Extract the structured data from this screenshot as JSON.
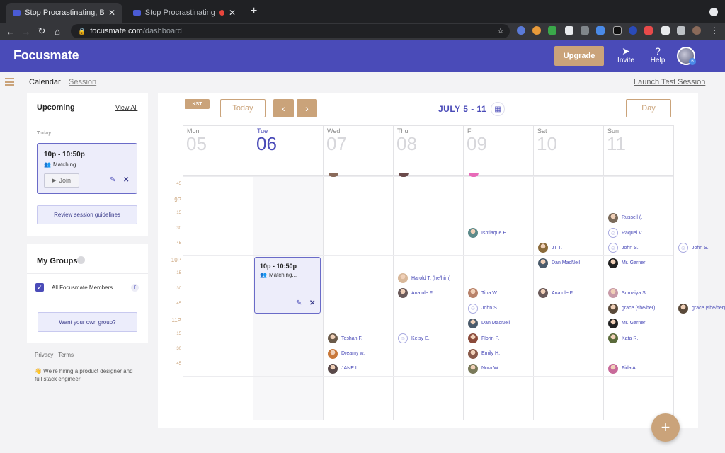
{
  "browser": {
    "tabs": [
      {
        "title": "Stop Procrastinating, Boost Pr..."
      },
      {
        "title": "Stop Procrastinating, Boos..."
      }
    ],
    "url_host": "focusmate.com",
    "url_path": "/dashboard"
  },
  "header": {
    "logo": "Focusmate",
    "upgrade": "Upgrade",
    "invite": "Invite",
    "help": "Help",
    "avatar_badge": "6"
  },
  "subnav": {
    "calendar": "Calendar",
    "session": "Session",
    "launch_test": "Launch Test Session"
  },
  "upcoming": {
    "title": "Upcoming",
    "view_all": "View All",
    "today": "Today",
    "session_time": "10p - 10:50p",
    "session_status": "Matching...",
    "join": "Join",
    "guidelines": "Review session guidelines"
  },
  "groups": {
    "title": "My Groups",
    "info": "i",
    "member": "All Focusmate Members",
    "member_badge": "F",
    "own_group": "Want your own group?"
  },
  "footer": {
    "privacy": "Privacy",
    "sep": " · ",
    "terms": "Terms",
    "hiring": "👋 We're hiring a product designer and full stack engineer!"
  },
  "calendar": {
    "tz": "KST",
    "today_btn": "Today",
    "range": "JULY 5 - 11",
    "view": "Day",
    "days": [
      {
        "name": "Mon",
        "num": "05"
      },
      {
        "name": "Tue",
        "num": "06"
      },
      {
        "name": "Wed",
        "num": "07"
      },
      {
        "name": "Thu",
        "num": "08"
      },
      {
        "name": "Fri",
        "num": "09"
      },
      {
        "name": "Sat",
        "num": "10"
      },
      {
        "name": "Sun",
        "num": "11"
      }
    ],
    "times": [
      ":45",
      "9P",
      ":15",
      ":30",
      ":45",
      "10P",
      ":15",
      ":30",
      ":45",
      "11P",
      ":15",
      ":30",
      ":45"
    ],
    "event_time": "10p - 10:50p",
    "event_status": "Matching..."
  },
  "people": [
    {
      "day": 4,
      "slot": 1,
      "name": "Russell (.",
      "color": "#7a6a5a"
    },
    {
      "day": 2,
      "slot": 2,
      "name": "Ishtiaque H.",
      "color": "#5c8a8a"
    },
    {
      "day": 4,
      "slot": 2,
      "name": "Raquel V.",
      "color": ""
    },
    {
      "day": 3,
      "slot": 3,
      "name": "JT T.",
      "color": "#8a6a3a"
    },
    {
      "day": 4,
      "slot": 3,
      "name": "John S.",
      "color": ""
    },
    {
      "day": 5,
      "slot": 3,
      "name": "John S.",
      "color": ""
    },
    {
      "day": 3,
      "slot": 4,
      "name": "Dan MacNeil",
      "color": "#4a5a6a"
    },
    {
      "day": 4,
      "slot": 4,
      "name": "Mr. Garner",
      "color": "#222222"
    },
    {
      "day": 1,
      "slot": 5,
      "name": "Harold T. (he/him)",
      "color": "#d8b89a"
    },
    {
      "day": 1,
      "slot": 6,
      "name": "Anatole F.",
      "color": "#6a5a5a"
    },
    {
      "day": 2,
      "slot": 6,
      "name": "Tina W.",
      "color": "#b8826a"
    },
    {
      "day": 3,
      "slot": 6,
      "name": "Anatole F.",
      "color": "#6a5a5a"
    },
    {
      "day": 4,
      "slot": 6,
      "name": "Sumaiya S.",
      "color": "#c89aa8"
    },
    {
      "day": 2,
      "slot": 7,
      "name": "John S.",
      "color": ""
    },
    {
      "day": 4,
      "slot": 7,
      "name": "grace (she/her)",
      "color": "#5a4a3a"
    },
    {
      "day": 5,
      "slot": 7,
      "name": "grace (she/her)",
      "color": "#5a4a3a"
    },
    {
      "day": 2,
      "slot": 8,
      "name": "Dan MacNeil",
      "color": "#4a5a6a"
    },
    {
      "day": 4,
      "slot": 8,
      "name": "Mr. Garner",
      "color": "#222222"
    },
    {
      "day": 0,
      "slot": 9,
      "name": "Teshan F.",
      "color": "#6a5a4a"
    },
    {
      "day": 1,
      "slot": 9,
      "name": "Kelsy E.",
      "color": ""
    },
    {
      "day": 2,
      "slot": 9,
      "name": "Florin P.",
      "color": "#8a4a3a"
    },
    {
      "day": 4,
      "slot": 9,
      "name": "Kata R.",
      "color": "#5a6a3a"
    },
    {
      "day": 0,
      "slot": 10,
      "name": "Dreamy w.",
      "color": "#c8783a"
    },
    {
      "day": 2,
      "slot": 10,
      "name": "Emily H.",
      "color": "#8a5a4a"
    },
    {
      "day": 0,
      "slot": 11,
      "name": "JANE L.",
      "color": "#5a4a4a"
    },
    {
      "day": 2,
      "slot": 11,
      "name": "Nora W.",
      "color": "#7a7a5a"
    },
    {
      "day": 4,
      "slot": 11,
      "name": "Fida A.",
      "color": "#c86a9a"
    }
  ],
  "colors": {
    "brand": "#4a4bb8",
    "accent": "#caa37a"
  },
  "fab": "+"
}
